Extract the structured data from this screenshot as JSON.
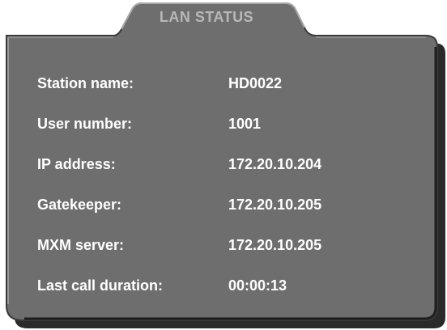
{
  "panel": {
    "title": "LAN STATUS",
    "rows": [
      {
        "label": "Station name:",
        "value": "HD0022"
      },
      {
        "label": "User number:",
        "value": "1001"
      },
      {
        "label": "IP address:",
        "value": "172.20.10.204"
      },
      {
        "label": "Gatekeeper:",
        "value": "172.20.10.205"
      },
      {
        "label": "MXM server:",
        "value": "172.20.10.205"
      },
      {
        "label": "Last call duration:",
        "value": "00:00:13"
      }
    ]
  },
  "colors": {
    "panel_fill": "#6e6e6e",
    "panel_edge_light": "#9a9a9a",
    "panel_edge_dark": "#2a2a2a",
    "title_text": "#b8b8b8",
    "text": "#ffffff"
  }
}
